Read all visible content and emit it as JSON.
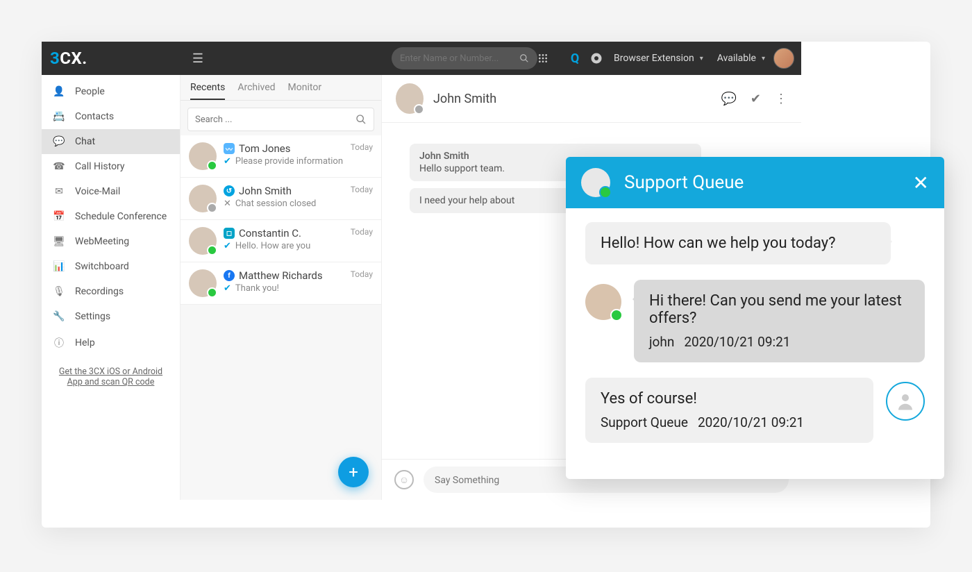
{
  "brand": {
    "a": "3",
    "b": "CX."
  },
  "colors": {
    "accent": "#00a3e0",
    "green": "#29c940",
    "popup": "#14a8dc"
  },
  "topbar": {
    "search_placeholder": "Enter Name or Number...",
    "browser_ext": "Browser Extension",
    "status": "Available"
  },
  "sidebar": {
    "items": [
      {
        "icon": "👤",
        "label": "People"
      },
      {
        "icon": "📇",
        "label": "Contacts"
      },
      {
        "icon": "💬",
        "label": "Chat",
        "active": true
      },
      {
        "icon": "☎",
        "label": "Call History"
      },
      {
        "icon": "✉",
        "label": "Voice-Mail"
      },
      {
        "icon": "📅",
        "label": "Schedule Conference"
      },
      {
        "icon": "🖥",
        "label": "WebMeeting"
      },
      {
        "icon": "📊",
        "label": "Switchboard"
      },
      {
        "icon": "🎙",
        "label": "Recordings"
      },
      {
        "icon": "🔧",
        "label": "Settings"
      },
      {
        "icon": "ⓘ",
        "label": "Help"
      }
    ],
    "footer": "Get the 3CX iOS or Android App and scan QR code"
  },
  "tabs": {
    "recents": "Recents",
    "archived": "Archived",
    "monitor": "Monitor"
  },
  "list_search_placeholder": "Search ...",
  "chats": [
    {
      "name": "Tom Jones",
      "time": "Today",
      "src": "w",
      "srcTxt": "〰",
      "sub": "Please provide information",
      "subicon": "tick",
      "status": "green"
    },
    {
      "name": "John Smith",
      "time": "Today",
      "src": "3",
      "srcTxt": "↺",
      "sub": "Chat session closed",
      "subicon": "x",
      "status": "gray"
    },
    {
      "name": "Constantin C.",
      "time": "Today",
      "src": "d",
      "srcTxt": "◻",
      "sub": "Hello. How are you",
      "subicon": "tick",
      "status": "green"
    },
    {
      "name": "Matthew Richards",
      "time": "Today",
      "src": "f",
      "srcTxt": "f",
      "sub": "Thank you!",
      "subicon": "tick",
      "status": "green"
    }
  ],
  "conversation": {
    "title": "John Smith",
    "msg1_from": "John Smith",
    "msg1_text": "Hello support team.",
    "msg2_text": "I need your help about",
    "composer_placeholder": "Say Something"
  },
  "popup": {
    "title": "Support Queue",
    "m1": "Hello! How can we help you today?",
    "m2": "Hi there! Can you send me your latest offers?",
    "m2_auth": "john",
    "m2_ts": "2020/10/21 09:21",
    "m3": "Yes of course!",
    "m3_auth": "Support Queue",
    "m3_ts": "2020/10/21 09:21"
  }
}
